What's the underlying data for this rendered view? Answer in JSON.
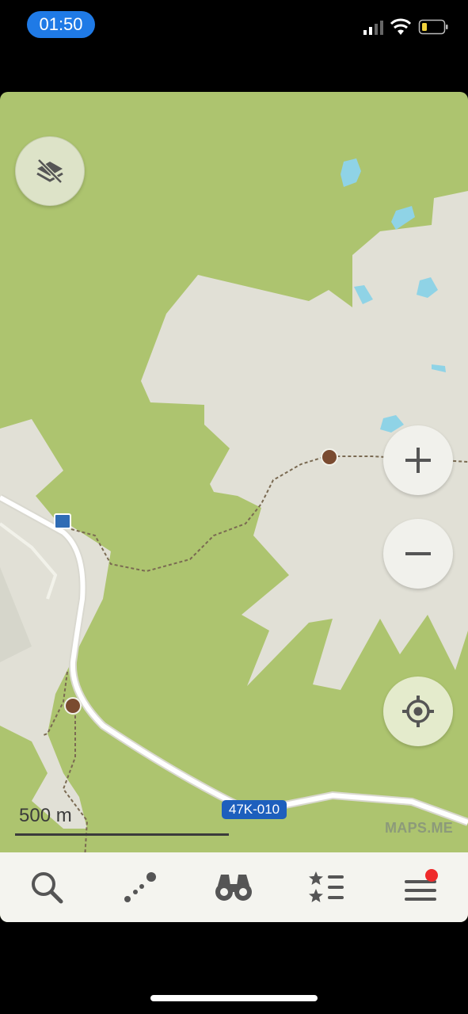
{
  "status_bar": {
    "time": "01:50",
    "icons": [
      "cellular-signal-icon",
      "wifi-icon",
      "battery-low-icon"
    ]
  },
  "map": {
    "road_shield": "47K-010",
    "scale_label": "500 m",
    "watermark": "MAPS.ME",
    "colors": {
      "forest": "#adc46f",
      "rock": "#e1e0d6",
      "water": "#8fd3e6",
      "road": "#ffffff",
      "trail": "#7a6a52"
    },
    "controls": {
      "layers": "layers-off-icon",
      "zoom_in": "plus-icon",
      "zoom_out": "minus-icon",
      "my_location": "crosshair-icon"
    },
    "pois": [
      "viewpoint-icon",
      "viewpoint-icon",
      "building-icon"
    ]
  },
  "toolbar": {
    "items": [
      "search-icon",
      "route-icon",
      "discovery-binoculars-icon",
      "bookmarks-icon",
      "menu-icon"
    ],
    "menu_badge_color": "#ef2a2a"
  }
}
